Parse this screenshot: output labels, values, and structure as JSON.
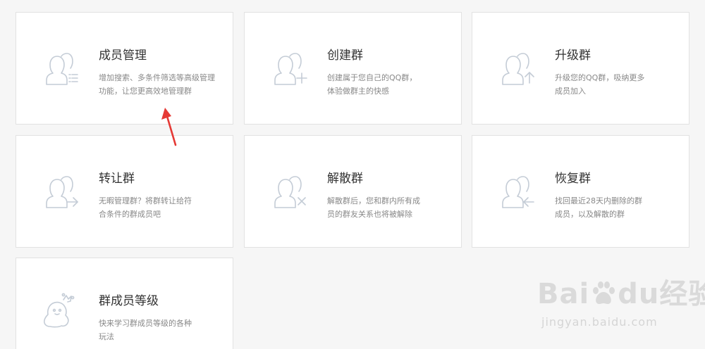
{
  "cards": [
    {
      "title": "成员管理",
      "desc": "增加搜索、多条件筛选等高级管理\n功能，让您更高效地管理群"
    },
    {
      "title": "创建群",
      "desc": "创建属于您自己的QQ群，\n体验做群主的快感"
    },
    {
      "title": "升级群",
      "desc": "升级您的QQ群，吸纳更多\n成员加入"
    },
    {
      "title": "转让群",
      "desc": "无暇管理群？将群转让给符\n合条件的群成员吧"
    },
    {
      "title": "解散群",
      "desc": "解散群后，您和群内所有成\n员的群友关系也将被解除"
    },
    {
      "title": "恢复群",
      "desc": "找回最近28天内删除的群\n成员，以及解散的群"
    },
    {
      "title": "群成员等级",
      "desc": "快来学习群成员等级的各种\n玩法"
    }
  ],
  "icons": [
    "members-list-icon",
    "user-plus-icon",
    "user-up-arrow-icon",
    "user-transfer-icon",
    "user-remove-icon",
    "user-restore-icon",
    "penguin-icon"
  ],
  "watermark": {
    "logo_a": "Bai",
    "logo_b": "du",
    "logo_c": "经验",
    "url": "jingyan.baidu.com"
  },
  "colors": {
    "icon": "#c4ccd6",
    "arrow": "#e53935",
    "border": "#e2e2e2",
    "title": "#333333",
    "desc": "#888888"
  }
}
